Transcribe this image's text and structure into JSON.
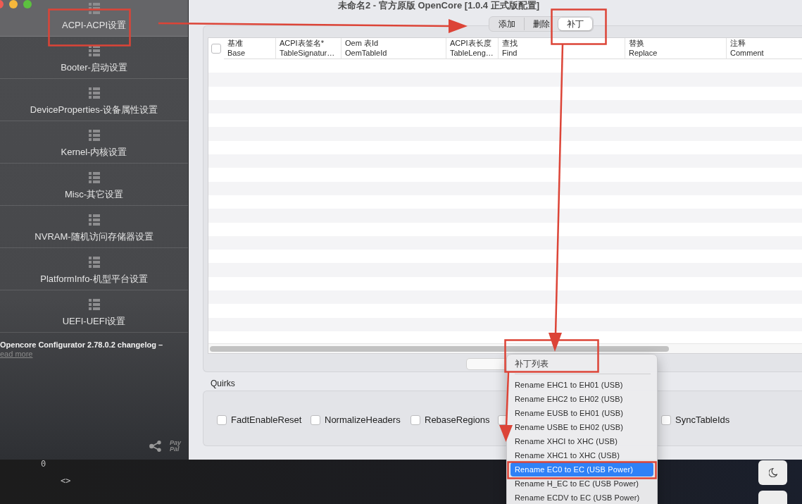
{
  "window": {
    "title": "未命名2 - 官方原版 OpenCore [1.0.4 正式版配置]"
  },
  "sidebar": {
    "items": [
      {
        "label": "ACPI-ACPI设置",
        "selected": true
      },
      {
        "label": "Booter-启动设置",
        "selected": false
      },
      {
        "label": "DeviceProperties-设备属性设置",
        "selected": false
      },
      {
        "label": "Kernel-内核设置",
        "selected": false
      },
      {
        "label": "Misc-其它设置",
        "selected": false
      },
      {
        "label": "NVRAM-随机访问存储器设置",
        "selected": false
      },
      {
        "label": "PlatformInfo-机型平台设置",
        "selected": false
      },
      {
        "label": "UEFI-UEFI设置",
        "selected": false
      }
    ],
    "changelog": {
      "text": "Opencore Configurator 2.78.0.2 changelog –",
      "link": "ead more"
    },
    "donate_logo": {
      "lines": [
        "Pay",
        "Pal"
      ]
    }
  },
  "tabs": [
    {
      "label": "添加",
      "selected": false
    },
    {
      "label": "删除",
      "selected": false
    },
    {
      "label": "补丁",
      "selected": true
    }
  ],
  "table": {
    "select_all": {
      "checked": false
    },
    "columns": [
      {
        "label": "基准",
        "key": "Base"
      },
      {
        "label": "ACPI表签名*",
        "key": "TableSignatur…"
      },
      {
        "label": "Oem 表Id",
        "key": "OemTableId"
      },
      {
        "label": "ACPI表长度",
        "key": "TableLeng…"
      },
      {
        "label": "查找",
        "key": "Find"
      },
      {
        "label": "替换",
        "key": "Replace"
      },
      {
        "label": "注释",
        "key": "Comment"
      }
    ]
  },
  "quirks": {
    "title": "Quirks",
    "items": [
      {
        "label": "FadtEnableReset",
        "checked": false
      },
      {
        "label": "NormalizeHeaders",
        "checked": false
      },
      {
        "label": "RebaseRegions",
        "checked": false
      },
      {
        "checked": false
      },
      {
        "label": "SyncTableIds",
        "checked": false
      }
    ]
  },
  "popup_menu": {
    "heading": "补丁列表",
    "items": [
      {
        "label": "Rename EHC1 to EH01 (USB)",
        "selected": false
      },
      {
        "label": "Rename EHC2 to EH02 (USB)",
        "selected": false
      },
      {
        "label": "Rename EUSB to EH01 (USB)",
        "selected": false
      },
      {
        "label": "Rename USBE to EH02 (USB)",
        "selected": false
      },
      {
        "label": "Rename XHCI to XHC (USB)",
        "selected": false
      },
      {
        "label": "Rename XHC1 to XHC (USB)",
        "selected": false
      },
      {
        "label": "Rename EC0 to EC (USB Power)",
        "selected": true
      },
      {
        "label": "Rename H_EC to EC (USB Power)",
        "selected": false
      },
      {
        "label": "Rename ECDV to EC (USB Power)",
        "selected": false
      }
    ]
  },
  "terminal": {
    "lines": [
      "0",
      "<>"
    ]
  }
}
